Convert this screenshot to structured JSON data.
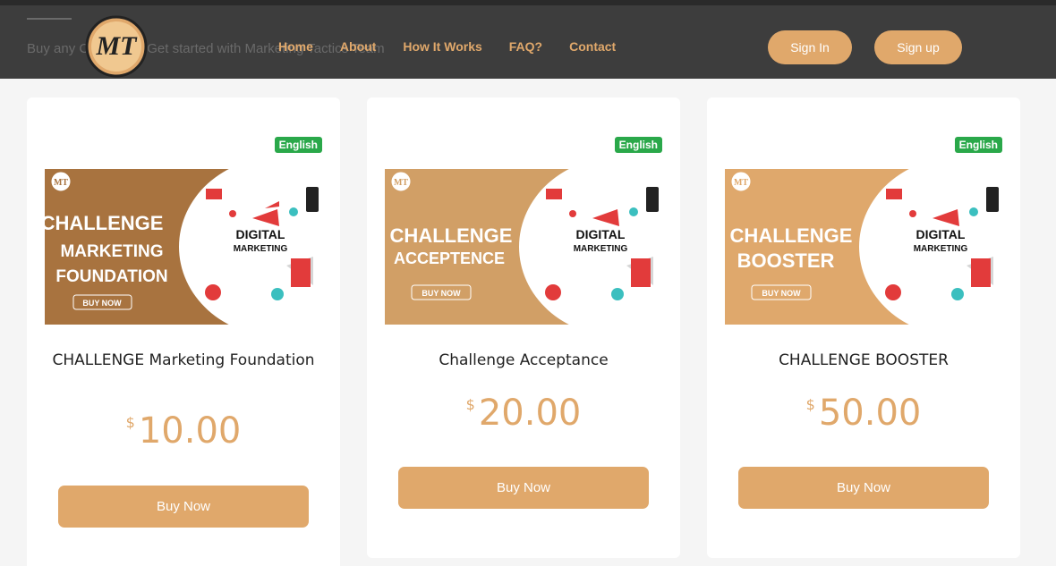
{
  "header": {
    "behind_text": "Buy any Challenge. Get started with Marketing Tactics Team",
    "logo_text": "MT",
    "nav": [
      "Home",
      "About",
      "How It Works",
      "FAQ?",
      "Contact"
    ],
    "sign_in": "Sign In",
    "sign_up": "Sign up"
  },
  "colors": {
    "accent": "#e0a86b",
    "header_bg": "#3d3d3d",
    "badge_green": "#2aa84a"
  },
  "cards": [
    {
      "badge": "English",
      "banner_lines": [
        "CHALLENGE",
        "MARKETING",
        "FOUNDATION"
      ],
      "banner_cta": "BUY NOW",
      "banner_right": [
        "DIGITAL",
        "MARKETING"
      ],
      "title": "CHALLENGE Marketing Foundation",
      "currency": "$",
      "price": "10.00",
      "button": "Buy Now"
    },
    {
      "badge": "English",
      "banner_lines": [
        "CHALLENGE",
        "ACCEPTENCE"
      ],
      "banner_cta": "BUY NOW",
      "banner_right": [
        "DIGITAL",
        "MARKETING"
      ],
      "title": "Challenge Acceptance",
      "currency": "$",
      "price": "20.00",
      "button": "Buy Now"
    },
    {
      "badge": "English",
      "banner_lines": [
        "CHALLENGE",
        "BOOSTER"
      ],
      "banner_cta": "BUY NOW",
      "banner_right": [
        "DIGITAL",
        "MARKETING"
      ],
      "title": "CHALLENGE BOOSTER",
      "currency": "$",
      "price": "50.00",
      "button": "Buy Now"
    }
  ]
}
